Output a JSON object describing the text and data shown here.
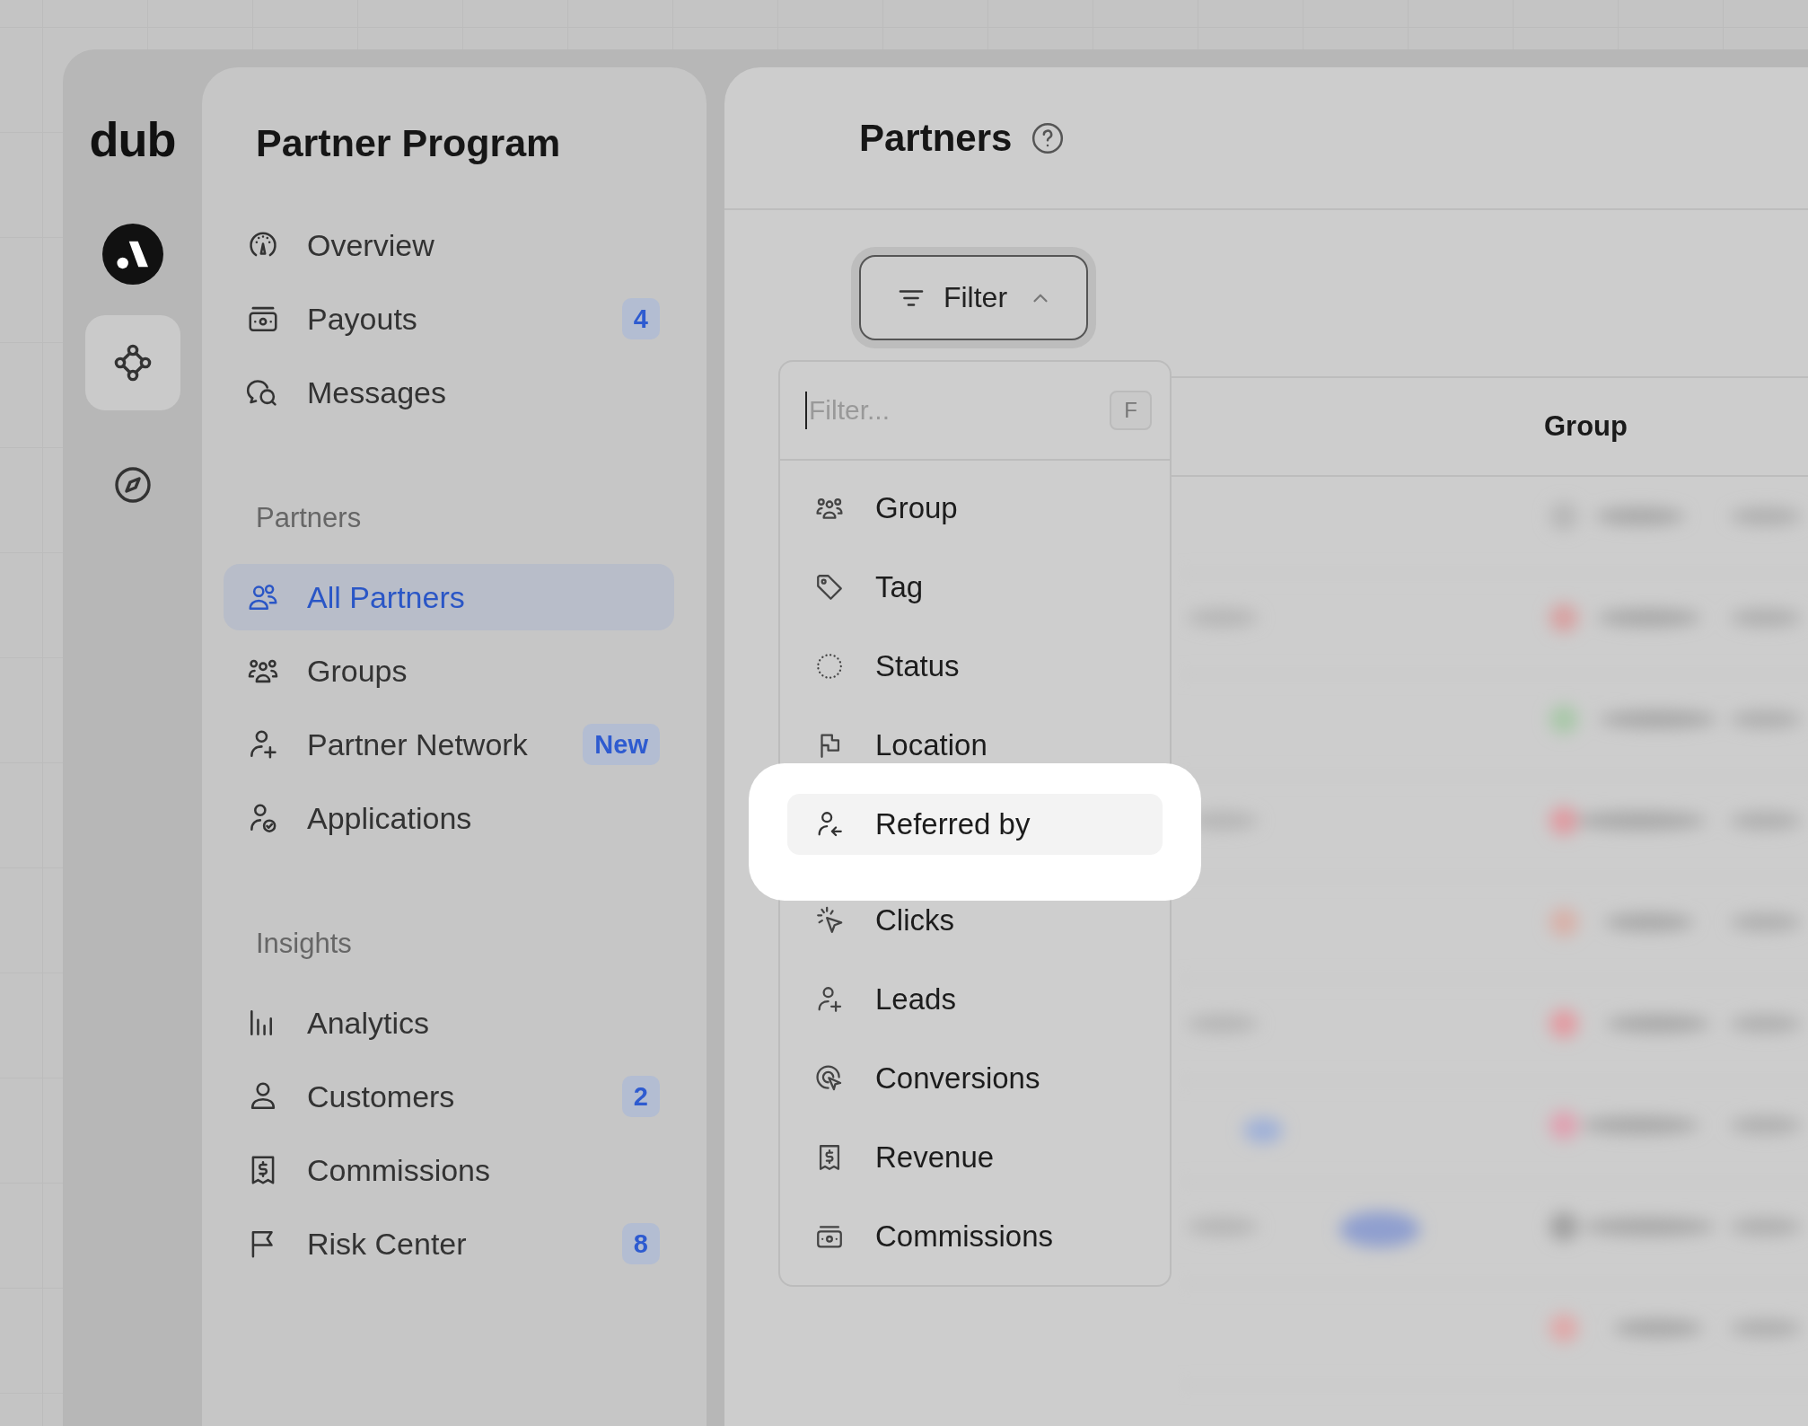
{
  "logo": "dub",
  "rail": [
    {
      "selected": true
    },
    {
      "selected": false
    }
  ],
  "sidebar": {
    "title": "Partner Program",
    "sections": [
      {
        "items": [
          {
            "label": "Overview",
            "selected": false
          },
          {
            "label": "Payouts",
            "selected": false,
            "badge": "4"
          },
          {
            "label": "Messages",
            "selected": false
          }
        ]
      },
      {
        "heading": "Partners",
        "items": [
          {
            "label": "All Partners",
            "selected": true
          },
          {
            "label": "Groups",
            "selected": false
          },
          {
            "label": "Partner Network",
            "selected": false,
            "badge": "New"
          },
          {
            "label": "Applications",
            "selected": false
          }
        ]
      },
      {
        "heading": "Insights",
        "items": [
          {
            "label": "Analytics",
            "selected": false
          },
          {
            "label": "Customers",
            "selected": false,
            "badge": "2"
          },
          {
            "label": "Commissions",
            "selected": false
          },
          {
            "label": "Risk Center",
            "selected": false,
            "badge": "8"
          }
        ]
      }
    ]
  },
  "main": {
    "title": "Partners",
    "filter_button": {
      "label": "Filter",
      "expanded": true
    },
    "filter_menu": {
      "placeholder": "Filter...",
      "shortcut": "F",
      "groups": [
        {
          "items": [
            {
              "label": "Group",
              "selected": false
            },
            {
              "label": "Tag",
              "selected": false
            },
            {
              "label": "Status",
              "selected": false
            },
            {
              "label": "Location",
              "selected": false
            },
            {
              "label": "Referred by",
              "selected": true
            }
          ]
        },
        {
          "items": [
            {
              "label": "Clicks",
              "selected": false
            },
            {
              "label": "Leads",
              "selected": false
            },
            {
              "label": "Conversions",
              "selected": false
            },
            {
              "label": "Revenue",
              "selected": false
            },
            {
              "label": "Commissions",
              "selected": false
            }
          ]
        }
      ]
    },
    "table": {
      "columns": [
        {
          "label": "Group"
        }
      ]
    }
  }
}
